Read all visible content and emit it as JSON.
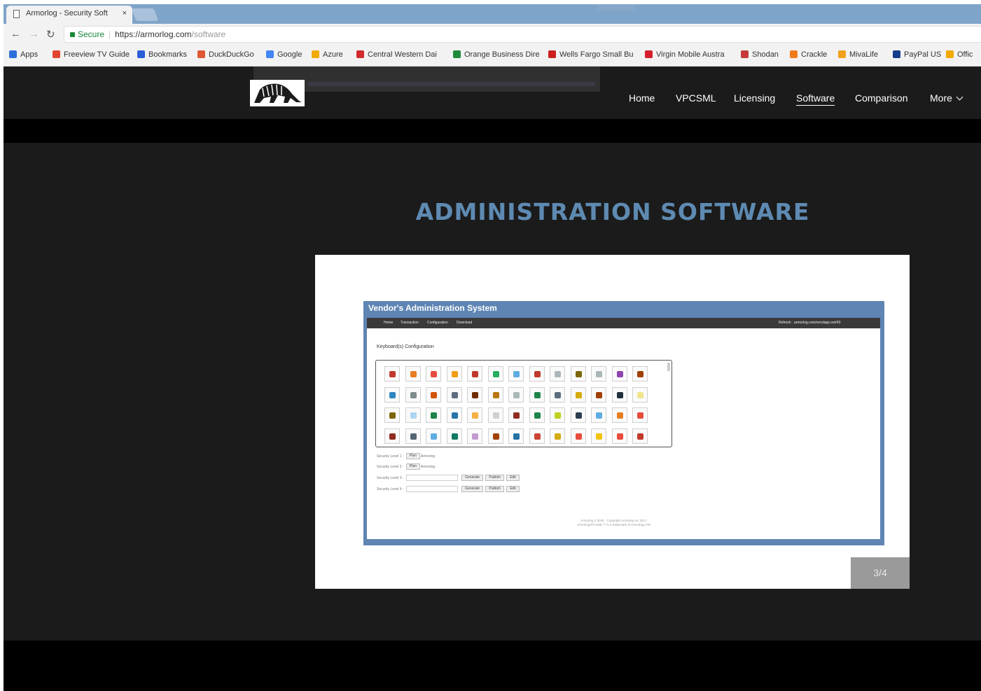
{
  "browser": {
    "tab_title": "Armorlog - Security Soft",
    "tab_close": "×",
    "secure_label": "Secure",
    "url_host": "https://armorlog.com",
    "url_path": "/software",
    "bookmarks": [
      {
        "label": "Apps",
        "color": "#2c6fdb"
      },
      {
        "label": "Freeview TV Guide",
        "color": "#e0462f"
      },
      {
        "label": "Bookmarks",
        "color": "#2c5fd6"
      },
      {
        "label": "DuckDuckGo",
        "color": "#de5833"
      },
      {
        "label": "Google",
        "color": "#4285f4"
      },
      {
        "label": "Azure",
        "color": "#f2a900"
      },
      {
        "label": "Central Western Dai",
        "color": "#d12b2b"
      },
      {
        "label": "Orange Business Dire",
        "color": "#1f8a3a"
      },
      {
        "label": "Wells Fargo Small Bu",
        "color": "#cc1f1f"
      },
      {
        "label": "Virgin Mobile Austra",
        "color": "#d61f2c"
      },
      {
        "label": "Shodan",
        "color": "#c43a3a"
      },
      {
        "label": "Crackle",
        "color": "#f07b1c"
      },
      {
        "label": "MivaLife",
        "color": "#f0a21c"
      },
      {
        "label": "PayPal US",
        "color": "#163d8c"
      },
      {
        "label": "Offic",
        "color": "#f2a900"
      }
    ]
  },
  "site": {
    "nav": {
      "home": "Home",
      "vpcsml": "VPCSML",
      "licensing": "Licensing",
      "software": "Software",
      "comparison": "Comparison",
      "more": "More"
    },
    "page_title": "ADMINISTRATION SOFTWARE",
    "slide_counter": "3/4",
    "vendor_app": {
      "title": "Vendor's Administration System",
      "menu": [
        "Home",
        "Transaction",
        "Configuration",
        "Download"
      ],
      "menu_right": "Refresh · armorlog.com/vendapp.net/43",
      "heading": "Keyboard(s) Configuration",
      "security_levels": [
        {
          "label": "Security Level 1 :",
          "button": "Plan",
          "note": "Armorlog"
        },
        {
          "label": "Security Level 2 :",
          "button": "Plan",
          "note": "Armorlog"
        },
        {
          "label": "Security Level 3 :",
          "buttons": [
            "Generate",
            "Publish",
            "Edit"
          ]
        },
        {
          "label": "Security Level 4 :",
          "buttons": [
            "Generate",
            "Publish",
            "Edit"
          ]
        }
      ],
      "footer_line1": "Armorlog 3 2018 · Copyright Armorlog Inc 2017",
      "footer_line2": "ArmorlogVPCSML™ is a trademark of Armorlog LTD"
    },
    "key_colors": [
      "#c0392b",
      "#e67e22",
      "#e74c3c",
      "#f39c12",
      "#c0392b",
      "#27ae60",
      "#5dade2",
      "#c0392b",
      "#aab7b8",
      "#7d6608",
      "#aab7b8",
      "#8e44ad",
      "#a04000",
      "#2e86c1",
      "#7f8c8d",
      "#d35400",
      "#5d6d7e",
      "#6e2c00",
      "#b9770e",
      "#aab7b8",
      "#1e8449",
      "#5d6d7e",
      "#d4ac0d",
      "#a04000",
      "#212f3d",
      "#f0e68c",
      "#7d6608",
      "#aed6f1",
      "#1d8348",
      "#2874a6",
      "#f5b041",
      "#ccd1d1",
      "#922b21",
      "#1e8449",
      "#c0d020",
      "#2c3e50",
      "#5dade2",
      "#e67e22",
      "#e74c3c",
      "#922b21",
      "#566573",
      "#5dade2",
      "#117a65",
      "#c39bd3",
      "#a04000",
      "#2471a3",
      "#cb4335",
      "#d4ac0d",
      "#e74c3c",
      "#f1c40f",
      "#e74c3c"
    ]
  }
}
